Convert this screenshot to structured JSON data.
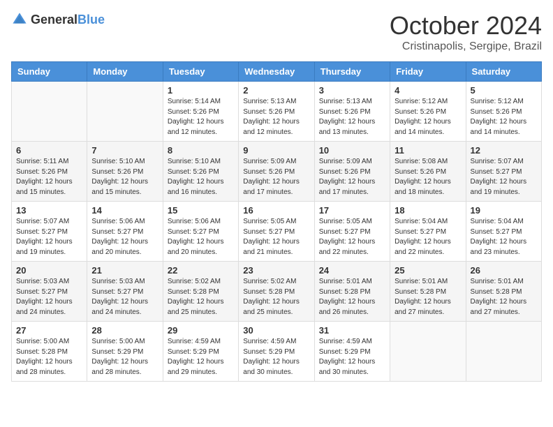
{
  "logo": {
    "general": "General",
    "blue": "Blue"
  },
  "title": {
    "month": "October 2024",
    "location": "Cristinapolis, Sergipe, Brazil"
  },
  "headers": [
    "Sunday",
    "Monday",
    "Tuesday",
    "Wednesday",
    "Thursday",
    "Friday",
    "Saturday"
  ],
  "weeks": [
    [
      {
        "day": "",
        "text": ""
      },
      {
        "day": "",
        "text": ""
      },
      {
        "day": "1",
        "text": "Sunrise: 5:14 AM\nSunset: 5:26 PM\nDaylight: 12 hours and 12 minutes."
      },
      {
        "day": "2",
        "text": "Sunrise: 5:13 AM\nSunset: 5:26 PM\nDaylight: 12 hours and 12 minutes."
      },
      {
        "day": "3",
        "text": "Sunrise: 5:13 AM\nSunset: 5:26 PM\nDaylight: 12 hours and 13 minutes."
      },
      {
        "day": "4",
        "text": "Sunrise: 5:12 AM\nSunset: 5:26 PM\nDaylight: 12 hours and 14 minutes."
      },
      {
        "day": "5",
        "text": "Sunrise: 5:12 AM\nSunset: 5:26 PM\nDaylight: 12 hours and 14 minutes."
      }
    ],
    [
      {
        "day": "6",
        "text": "Sunrise: 5:11 AM\nSunset: 5:26 PM\nDaylight: 12 hours and 15 minutes."
      },
      {
        "day": "7",
        "text": "Sunrise: 5:10 AM\nSunset: 5:26 PM\nDaylight: 12 hours and 15 minutes."
      },
      {
        "day": "8",
        "text": "Sunrise: 5:10 AM\nSunset: 5:26 PM\nDaylight: 12 hours and 16 minutes."
      },
      {
        "day": "9",
        "text": "Sunrise: 5:09 AM\nSunset: 5:26 PM\nDaylight: 12 hours and 17 minutes."
      },
      {
        "day": "10",
        "text": "Sunrise: 5:09 AM\nSunset: 5:26 PM\nDaylight: 12 hours and 17 minutes."
      },
      {
        "day": "11",
        "text": "Sunrise: 5:08 AM\nSunset: 5:26 PM\nDaylight: 12 hours and 18 minutes."
      },
      {
        "day": "12",
        "text": "Sunrise: 5:07 AM\nSunset: 5:27 PM\nDaylight: 12 hours and 19 minutes."
      }
    ],
    [
      {
        "day": "13",
        "text": "Sunrise: 5:07 AM\nSunset: 5:27 PM\nDaylight: 12 hours and 19 minutes."
      },
      {
        "day": "14",
        "text": "Sunrise: 5:06 AM\nSunset: 5:27 PM\nDaylight: 12 hours and 20 minutes."
      },
      {
        "day": "15",
        "text": "Sunrise: 5:06 AM\nSunset: 5:27 PM\nDaylight: 12 hours and 20 minutes."
      },
      {
        "day": "16",
        "text": "Sunrise: 5:05 AM\nSunset: 5:27 PM\nDaylight: 12 hours and 21 minutes."
      },
      {
        "day": "17",
        "text": "Sunrise: 5:05 AM\nSunset: 5:27 PM\nDaylight: 12 hours and 22 minutes."
      },
      {
        "day": "18",
        "text": "Sunrise: 5:04 AM\nSunset: 5:27 PM\nDaylight: 12 hours and 22 minutes."
      },
      {
        "day": "19",
        "text": "Sunrise: 5:04 AM\nSunset: 5:27 PM\nDaylight: 12 hours and 23 minutes."
      }
    ],
    [
      {
        "day": "20",
        "text": "Sunrise: 5:03 AM\nSunset: 5:27 PM\nDaylight: 12 hours and 24 minutes."
      },
      {
        "day": "21",
        "text": "Sunrise: 5:03 AM\nSunset: 5:27 PM\nDaylight: 12 hours and 24 minutes."
      },
      {
        "day": "22",
        "text": "Sunrise: 5:02 AM\nSunset: 5:28 PM\nDaylight: 12 hours and 25 minutes."
      },
      {
        "day": "23",
        "text": "Sunrise: 5:02 AM\nSunset: 5:28 PM\nDaylight: 12 hours and 25 minutes."
      },
      {
        "day": "24",
        "text": "Sunrise: 5:01 AM\nSunset: 5:28 PM\nDaylight: 12 hours and 26 minutes."
      },
      {
        "day": "25",
        "text": "Sunrise: 5:01 AM\nSunset: 5:28 PM\nDaylight: 12 hours and 27 minutes."
      },
      {
        "day": "26",
        "text": "Sunrise: 5:01 AM\nSunset: 5:28 PM\nDaylight: 12 hours and 27 minutes."
      }
    ],
    [
      {
        "day": "27",
        "text": "Sunrise: 5:00 AM\nSunset: 5:28 PM\nDaylight: 12 hours and 28 minutes."
      },
      {
        "day": "28",
        "text": "Sunrise: 5:00 AM\nSunset: 5:29 PM\nDaylight: 12 hours and 28 minutes."
      },
      {
        "day": "29",
        "text": "Sunrise: 4:59 AM\nSunset: 5:29 PM\nDaylight: 12 hours and 29 minutes."
      },
      {
        "day": "30",
        "text": "Sunrise: 4:59 AM\nSunset: 5:29 PM\nDaylight: 12 hours and 30 minutes."
      },
      {
        "day": "31",
        "text": "Sunrise: 4:59 AM\nSunset: 5:29 PM\nDaylight: 12 hours and 30 minutes."
      },
      {
        "day": "",
        "text": ""
      },
      {
        "day": "",
        "text": ""
      }
    ]
  ]
}
